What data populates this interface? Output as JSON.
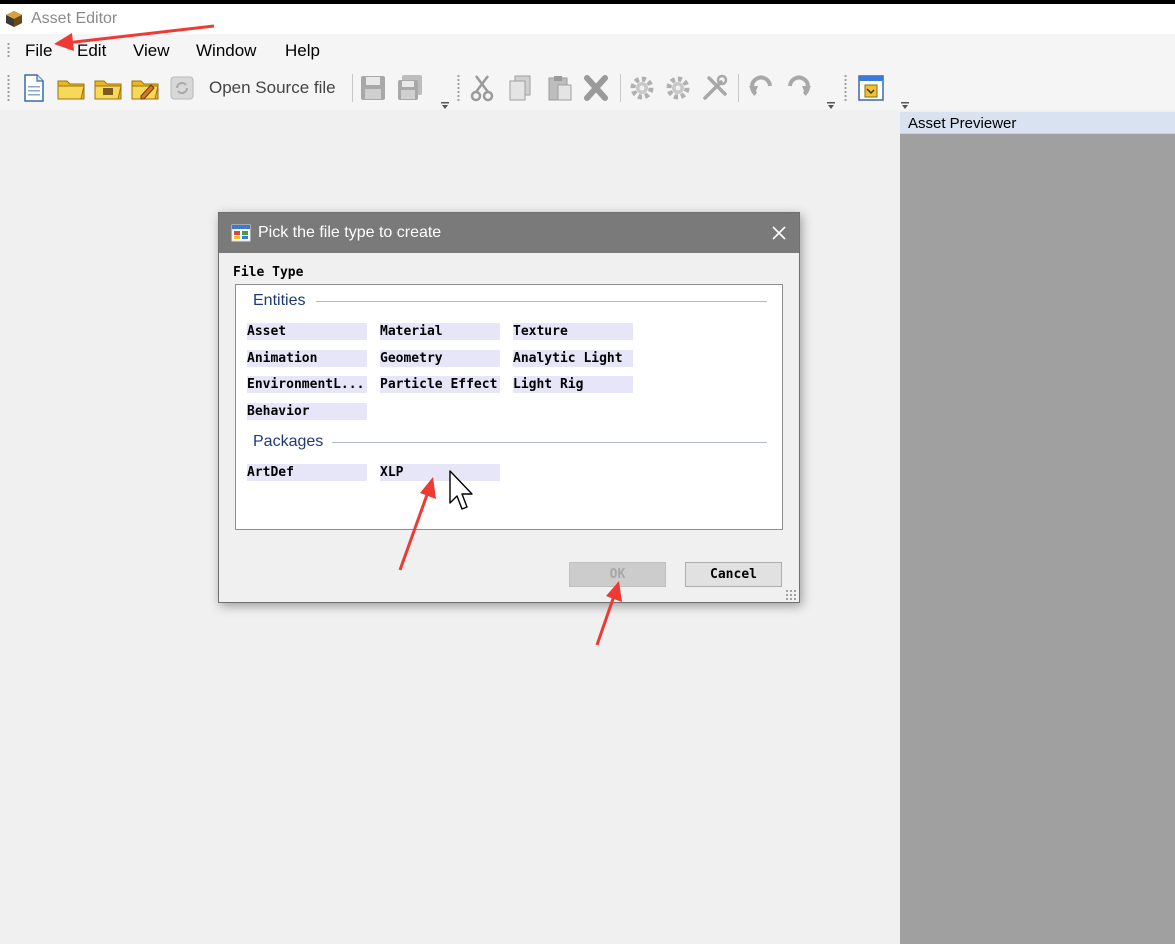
{
  "window": {
    "title": "Asset Editor"
  },
  "menu": {
    "items": [
      {
        "label": "File"
      },
      {
        "label": "Edit"
      },
      {
        "label": "View"
      },
      {
        "label": "Window"
      },
      {
        "label": "Help"
      }
    ]
  },
  "toolbar": {
    "open_source_label": "Open Source file",
    "icons": [
      "new-file-icon",
      "open-folder-icon",
      "open-folder-icon",
      "edit-folder-icon",
      "refresh-icon",
      "save-icon",
      "save-all-icon",
      "cut-icon",
      "copy-icon",
      "paste-icon",
      "delete-icon",
      "gear-icon",
      "gear-icon",
      "tools-icon",
      "undo-icon",
      "redo-icon",
      "window-icon"
    ]
  },
  "previewer": {
    "title": "Asset Previewer"
  },
  "dialog": {
    "title": "Pick the file type to create",
    "file_type_label": "File Type",
    "sections": [
      {
        "name": "Entities",
        "items": [
          "Asset",
          "Material",
          "Texture",
          "Animation",
          "Geometry",
          "Analytic Light",
          "EnvironmentL...",
          "Particle Effect",
          "Light Rig",
          "Behavior"
        ]
      },
      {
        "name": "Packages",
        "items": [
          "ArtDef",
          "XLP"
        ]
      }
    ],
    "ok_label": "OK",
    "cancel_label": "Cancel"
  },
  "colors": {
    "dialog_titlebar": "#7a7a7a",
    "section_header": "#1e3a78",
    "item_background": "#e6e6f8",
    "annotation_arrow": "#ee3a35",
    "previewer_background": "#a0a0a0"
  }
}
